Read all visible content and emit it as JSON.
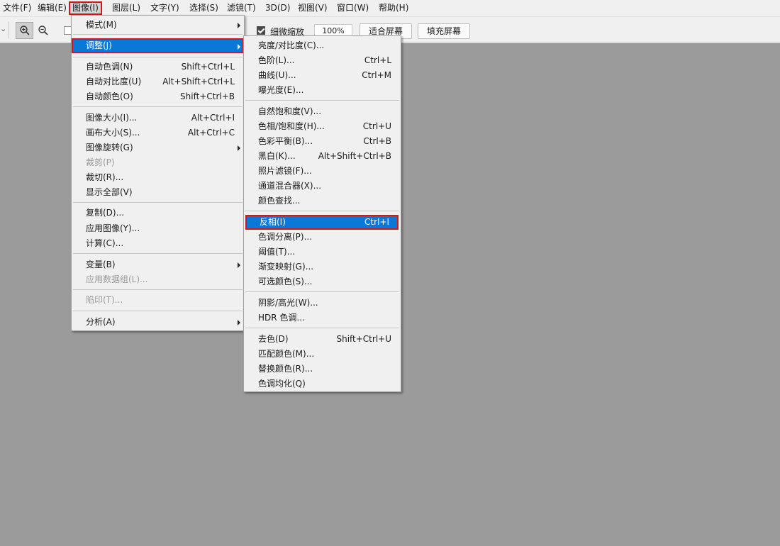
{
  "menubar": {
    "items": [
      {
        "label": "文件(F)"
      },
      {
        "label": "编辑(E)"
      },
      {
        "label": "图像(I)"
      },
      {
        "label": "图层(L)"
      },
      {
        "label": "文字(Y)"
      },
      {
        "label": "选择(S)"
      },
      {
        "label": "滤镜(T)"
      },
      {
        "label": "3D(D)"
      },
      {
        "label": "视图(V)"
      },
      {
        "label": "窗口(W)"
      },
      {
        "label": "帮助(H)"
      }
    ]
  },
  "toolbar": {
    "zoom_in_icon": "zoom-in-icon",
    "zoom_out_icon": "zoom-out-icon",
    "scrubby_zoom_label": "细微缩放",
    "scrubby_zoom_checked": true,
    "zoom_value": "100%",
    "fit_screen_label": "适合屏幕",
    "fill_screen_label": "填充屏幕"
  },
  "image_menu": {
    "groups": [
      [
        {
          "label": "模式(M)",
          "shortcut": "",
          "submenu": true
        },
        {
          "label": "调整(J)",
          "shortcut": "",
          "submenu": true,
          "highlighted": true
        }
      ],
      [
        {
          "label": "自动色调(N)",
          "shortcut": "Shift+Ctrl+L"
        },
        {
          "label": "自动对比度(U)",
          "shortcut": "Alt+Shift+Ctrl+L"
        },
        {
          "label": "自动颜色(O)",
          "shortcut": "Shift+Ctrl+B"
        }
      ],
      [
        {
          "label": "图像大小(I)...",
          "shortcut": "Alt+Ctrl+I"
        },
        {
          "label": "画布大小(S)...",
          "shortcut": "Alt+Ctrl+C"
        },
        {
          "label": "图像旋转(G)",
          "shortcut": "",
          "submenu": true
        },
        {
          "label": "裁剪(P)",
          "shortcut": "",
          "disabled": true
        },
        {
          "label": "裁切(R)...",
          "shortcut": ""
        },
        {
          "label": "显示全部(V)",
          "shortcut": ""
        }
      ],
      [
        {
          "label": "复制(D)...",
          "shortcut": ""
        },
        {
          "label": "应用图像(Y)...",
          "shortcut": ""
        },
        {
          "label": "计算(C)...",
          "shortcut": ""
        }
      ],
      [
        {
          "label": "变量(B)",
          "shortcut": "",
          "submenu": true
        },
        {
          "label": "应用数据组(L)...",
          "shortcut": "",
          "disabled": true
        }
      ],
      [
        {
          "label": "陷印(T)...",
          "shortcut": "",
          "disabled": true
        }
      ],
      [
        {
          "label": "分析(A)",
          "shortcut": "",
          "submenu": true
        }
      ]
    ]
  },
  "adjust_menu": {
    "groups": [
      [
        {
          "label": "亮度/对比度(C)...",
          "shortcut": ""
        },
        {
          "label": "色阶(L)...",
          "shortcut": "Ctrl+L"
        },
        {
          "label": "曲线(U)...",
          "shortcut": "Ctrl+M"
        },
        {
          "label": "曝光度(E)...",
          "shortcut": ""
        }
      ],
      [
        {
          "label": "自然饱和度(V)...",
          "shortcut": ""
        },
        {
          "label": "色相/饱和度(H)...",
          "shortcut": "Ctrl+U"
        },
        {
          "label": "色彩平衡(B)...",
          "shortcut": "Ctrl+B"
        },
        {
          "label": "黑白(K)...",
          "shortcut": "Alt+Shift+Ctrl+B"
        },
        {
          "label": "照片滤镜(F)...",
          "shortcut": ""
        },
        {
          "label": "通道混合器(X)...",
          "shortcut": ""
        },
        {
          "label": "颜色查找...",
          "shortcut": ""
        }
      ],
      [
        {
          "label": "反相(I)",
          "shortcut": "Ctrl+I",
          "highlighted": true
        },
        {
          "label": "色调分离(P)...",
          "shortcut": ""
        },
        {
          "label": "阈值(T)...",
          "shortcut": ""
        },
        {
          "label": "渐变映射(G)...",
          "shortcut": ""
        },
        {
          "label": "可选颜色(S)...",
          "shortcut": ""
        }
      ],
      [
        {
          "label": "阴影/高光(W)...",
          "shortcut": ""
        },
        {
          "label": "HDR 色调...",
          "shortcut": ""
        }
      ],
      [
        {
          "label": "去色(D)",
          "shortcut": "Shift+Ctrl+U"
        },
        {
          "label": "匹配颜色(M)...",
          "shortcut": ""
        },
        {
          "label": "替换颜色(R)...",
          "shortcut": ""
        },
        {
          "label": "色调均化(Q)",
          "shortcut": ""
        }
      ]
    ]
  },
  "colors": {
    "highlight": "#0a78d7",
    "annotation_border": "#d01818",
    "canvas": "#9b9b9b",
    "menu_background": "#f0f0f0"
  }
}
